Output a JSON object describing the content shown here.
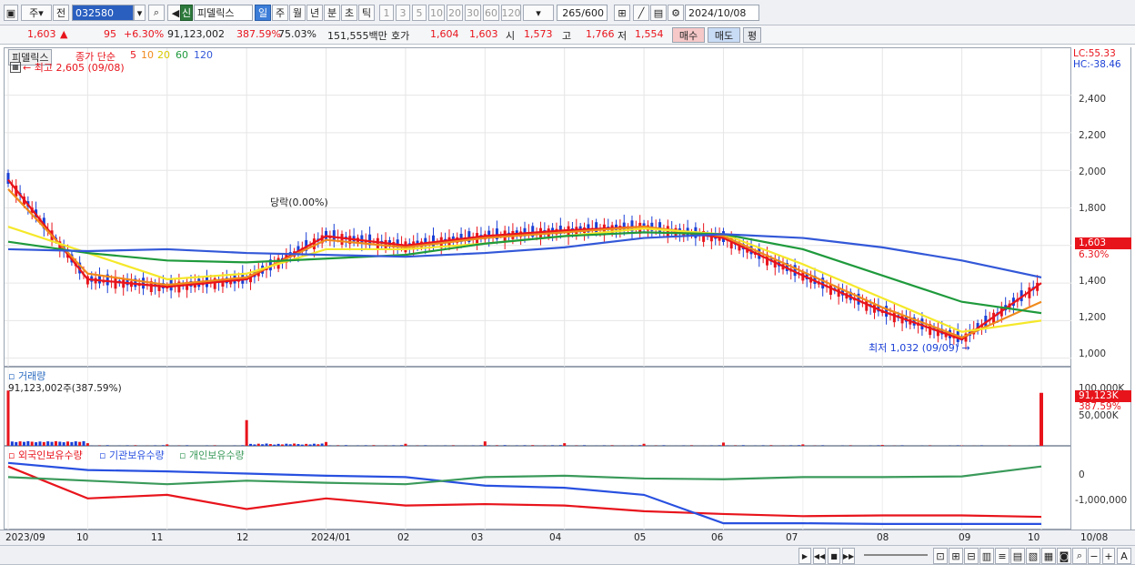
{
  "toolbar": {
    "mode_a": "주",
    "mode_b": "전",
    "code": "032580",
    "credit_badge": "신",
    "stock_name": "피델릭스",
    "periods": [
      "일",
      "주",
      "월",
      "년",
      "분",
      "초",
      "틱"
    ],
    "ticks": [
      "1",
      "3",
      "5",
      "10",
      "20",
      "30",
      "60",
      "120"
    ],
    "count": "265",
    "count_max": "/600",
    "date": "2024/10/08"
  },
  "quote": {
    "price": "1,603",
    "change": "95",
    "change_pct": "+6.30%",
    "volume": "91,123,002",
    "volume_pct": "387.59%",
    "turnover": "75.03%",
    "amount": "151,555백만",
    "bid_label": "호가",
    "bid1": "1,604",
    "bid2": "1,603",
    "open_label": "시",
    "open": "1,573",
    "high_label": "고",
    "high": "1,766",
    "low_label": "저",
    "low": "1,554",
    "buy": "매수",
    "sell": "매도",
    "eval": "평"
  },
  "price_panel": {
    "name": "피델릭스",
    "ma_label": "종가 단순",
    "ma_periods": [
      "5",
      "10",
      "20",
      "60",
      "120"
    ],
    "high_note": "최고 2,605 (09/08)",
    "low_note": "최저 1,032 (09/09)",
    "event_note": "당락(0.00%)",
    "lc": "LC:55.33",
    "hc": "HC:-38.46",
    "current_price": "1,603",
    "current_pct": "6.30%",
    "y_ticks": [
      "2,400",
      "2,200",
      "2,000",
      "1,800",
      "1,600",
      "1,400",
      "1,200",
      "1,000"
    ]
  },
  "volume_panel": {
    "title": "거래량",
    "value": "91,123,002주(387.59%)",
    "y_ticks": [
      "100,000K",
      "50,000K"
    ],
    "current": "91,123K",
    "current_pct": "387.59%"
  },
  "holding_panel": {
    "series": [
      "외국인보유수량",
      "기관보유수량",
      "개인보유수량"
    ],
    "y_ticks": [
      "0",
      "-1,000,000"
    ]
  },
  "x_axis": [
    "2023/09",
    "10",
    "11",
    "12",
    "2024/01",
    "02",
    "03",
    "04",
    "05",
    "06",
    "07",
    "08",
    "09",
    "10",
    "10/08"
  ],
  "colors": {
    "up": "#e8141c",
    "down": "#1a3fd6",
    "ma5": "#e8141c",
    "ma10": "#f08a1c",
    "ma20": "#f5e82a",
    "ma60": "#1f9a3c",
    "ma120": "#3358d8",
    "foreign": "#e8141c",
    "inst": "#2850e0",
    "individual": "#3a9a5a"
  },
  "chart_data": {
    "type": "line",
    "title": "",
    "ylim": [
      950,
      2650
    ],
    "categories": [
      "2023/09",
      "10",
      "11",
      "12",
      "2024/01",
      "02",
      "03",
      "04",
      "05",
      "06",
      "07",
      "08",
      "09",
      "10"
    ],
    "series": [
      {
        "name": "5",
        "values": [
          1950,
          1420,
          1380,
          1420,
          1650,
          1600,
          1650,
          1680,
          1700,
          1640,
          1440,
          1250,
          1100,
          1400
        ]
      },
      {
        "name": "10",
        "values": [
          1900,
          1450,
          1390,
          1430,
          1630,
          1590,
          1640,
          1670,
          1700,
          1650,
          1460,
          1270,
          1110,
          1300
        ]
      },
      {
        "name": "20",
        "values": [
          1700,
          1560,
          1420,
          1450,
          1580,
          1580,
          1610,
          1650,
          1690,
          1660,
          1500,
          1320,
          1140,
          1200
        ]
      },
      {
        "name": "60",
        "values": [
          1620,
          1560,
          1520,
          1510,
          1530,
          1550,
          1610,
          1650,
          1670,
          1660,
          1580,
          1440,
          1300,
          1240
        ]
      },
      {
        "name": "120",
        "values": [
          1580,
          1570,
          1580,
          1560,
          1550,
          1540,
          1560,
          1590,
          1640,
          1660,
          1640,
          1590,
          1520,
          1430
        ]
      }
    ],
    "volume_series": [
      {
        "name": "거래량",
        "values": [
          95000,
          6000,
          4000,
          45000,
          8000,
          5000,
          9000,
          6000,
          5000,
          7000,
          4000,
          3000,
          2000,
          91123
        ]
      }
    ]
  }
}
